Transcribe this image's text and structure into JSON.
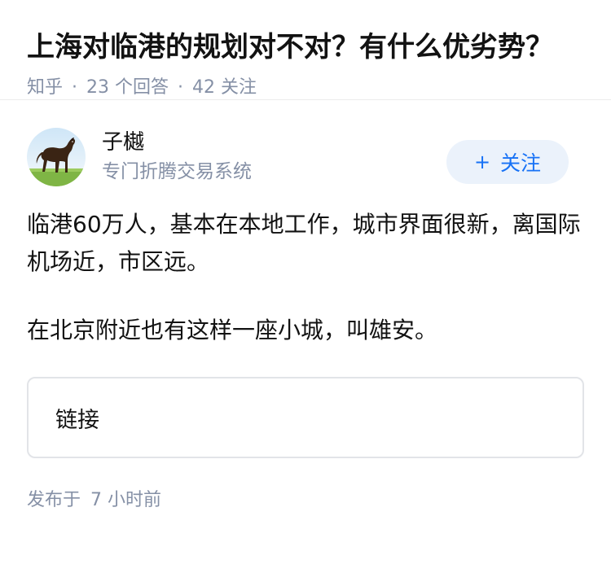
{
  "question": {
    "title": "上海对临港的规划对不对？有什么优劣势？",
    "source": "知乎",
    "answers_count": "23",
    "answers_label": "个回答",
    "followers_count": "42",
    "followers_label": "关注"
  },
  "answer": {
    "author": {
      "name": "子樾",
      "description": "专门折腾交易系统",
      "avatar_icon": "horse-avatar"
    },
    "follow_button": {
      "icon": "+",
      "label": "关注"
    },
    "paragraphs": [
      "临港60万人，基本在本地工作，城市界面很新，离国际机场近，市区远。",
      "在北京附近也有这样一座小城，叫雄安。"
    ],
    "link_card": {
      "label": "链接"
    },
    "publish": {
      "prefix": "发布于",
      "time": "7 小时前"
    }
  },
  "colors": {
    "meta_gray": "#8590a6",
    "accent_blue": "#1772f6",
    "follow_bg": "#ebf2fb",
    "text": "#121212"
  }
}
